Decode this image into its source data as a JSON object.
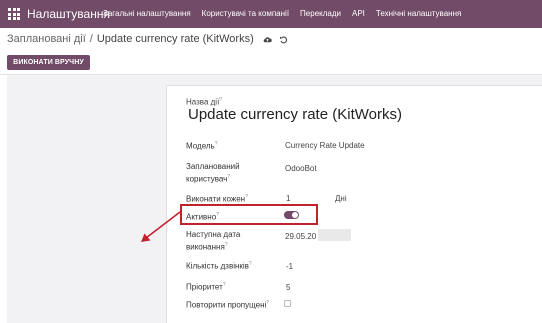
{
  "navbar": {
    "app_title": "Налаштування",
    "menu": [
      "Загальні налаштування",
      "Користувачі та компанії",
      "Переклади",
      "API",
      "Технічні налаштування"
    ]
  },
  "breadcrumb": {
    "parent": "Заплановані дії",
    "separator": "/",
    "current": "Update currency rate (KitWorks)"
  },
  "actions": {
    "run_manually": "ВИКОНАТИ ВРУЧНУ"
  },
  "form": {
    "name_label": "Назва дії",
    "name_value": "Update currency rate (KitWorks)",
    "model_label": "Модель",
    "model_value": "Currency Rate Update",
    "user_label_1": "Запланований",
    "user_label_2": "користувач",
    "user_value": "OdooBot",
    "interval_label": "Виконати кожен",
    "interval_number": "1",
    "interval_unit": "Дні",
    "active_label": "Активно",
    "active_value": true,
    "next_date_label_1": "Наступна дата",
    "next_date_label_2": "виконання",
    "next_date_value": "29.05.20",
    "calls_label": "Кількість дзвінків",
    "calls_value": "-1",
    "priority_label": "Пріоритет",
    "priority_value": "5",
    "repeat_missed_label": "Повторити пропущені",
    "repeat_missed_value": false,
    "help_mark": "?"
  },
  "colors": {
    "brand": "#714b67",
    "highlight": "#c0232d"
  }
}
